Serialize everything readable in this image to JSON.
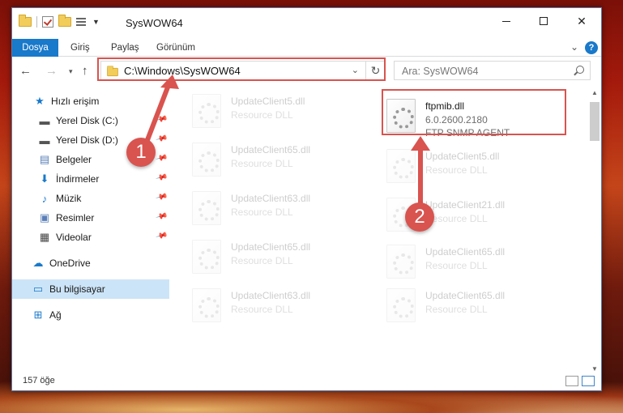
{
  "window": {
    "title": "SysWOW64"
  },
  "ribbon": {
    "tabs": [
      "Dosya",
      "Giriş",
      "Paylaş",
      "Görünüm"
    ],
    "help": "?"
  },
  "address": {
    "path": "C:\\Windows\\SysWOW64"
  },
  "search": {
    "placeholder": "Ara: SysWOW64"
  },
  "sidebar": {
    "items": [
      {
        "label": "Hızlı erişim",
        "icon": "star-icon"
      },
      {
        "label": "Yerel Disk (C:)",
        "icon": "drive-icon",
        "pinned": true
      },
      {
        "label": "Yerel Disk (D:)",
        "icon": "drive-icon",
        "pinned": true
      },
      {
        "label": "Belgeler",
        "icon": "documents-icon",
        "pinned": true
      },
      {
        "label": "İndirmeler",
        "icon": "download-icon",
        "pinned": true
      },
      {
        "label": "Müzik",
        "icon": "music-icon",
        "pinned": true
      },
      {
        "label": "Resimler",
        "icon": "pictures-icon",
        "pinned": true
      },
      {
        "label": "Videolar",
        "icon": "videos-icon",
        "pinned": true
      },
      {
        "label": "OneDrive",
        "icon": "cloud-icon"
      },
      {
        "label": "Bu bilgisayar",
        "icon": "computer-icon",
        "selected": true
      },
      {
        "label": "Ağ",
        "icon": "network-icon"
      }
    ]
  },
  "files": {
    "left": [
      {
        "name": "UpdateClient5.dll",
        "desc": "Resource DLL"
      },
      {
        "name": "UpdateClient65.dll",
        "desc": "Resource DLL"
      },
      {
        "name": "UpdateClient63.dll",
        "desc": "Resource DLL"
      },
      {
        "name": "UpdateClient65.dll",
        "desc": "Resource DLL"
      },
      {
        "name": "UpdateClient63.dll",
        "desc": "Resource DLL"
      }
    ],
    "highlighted": {
      "name": "ftpmib.dll",
      "version": "6.0.2600.2180",
      "desc": "FTP SNMP AGENT"
    },
    "right": [
      {
        "name": "UpdateClient5.dll",
        "desc": "Resource DLL"
      },
      {
        "name": "UpdateClient21.dll",
        "desc": "Resource DLL"
      },
      {
        "name": "UpdateClient65.dll",
        "desc": "Resource DLL"
      },
      {
        "name": "UpdateClient65.dll",
        "desc": "Resource DLL"
      }
    ]
  },
  "status": {
    "count": "157 öğe"
  },
  "callouts": [
    "1",
    "2"
  ],
  "colors": {
    "accent": "#1979ca",
    "highlight": "#d9534f",
    "selected": "#cce4f7"
  }
}
